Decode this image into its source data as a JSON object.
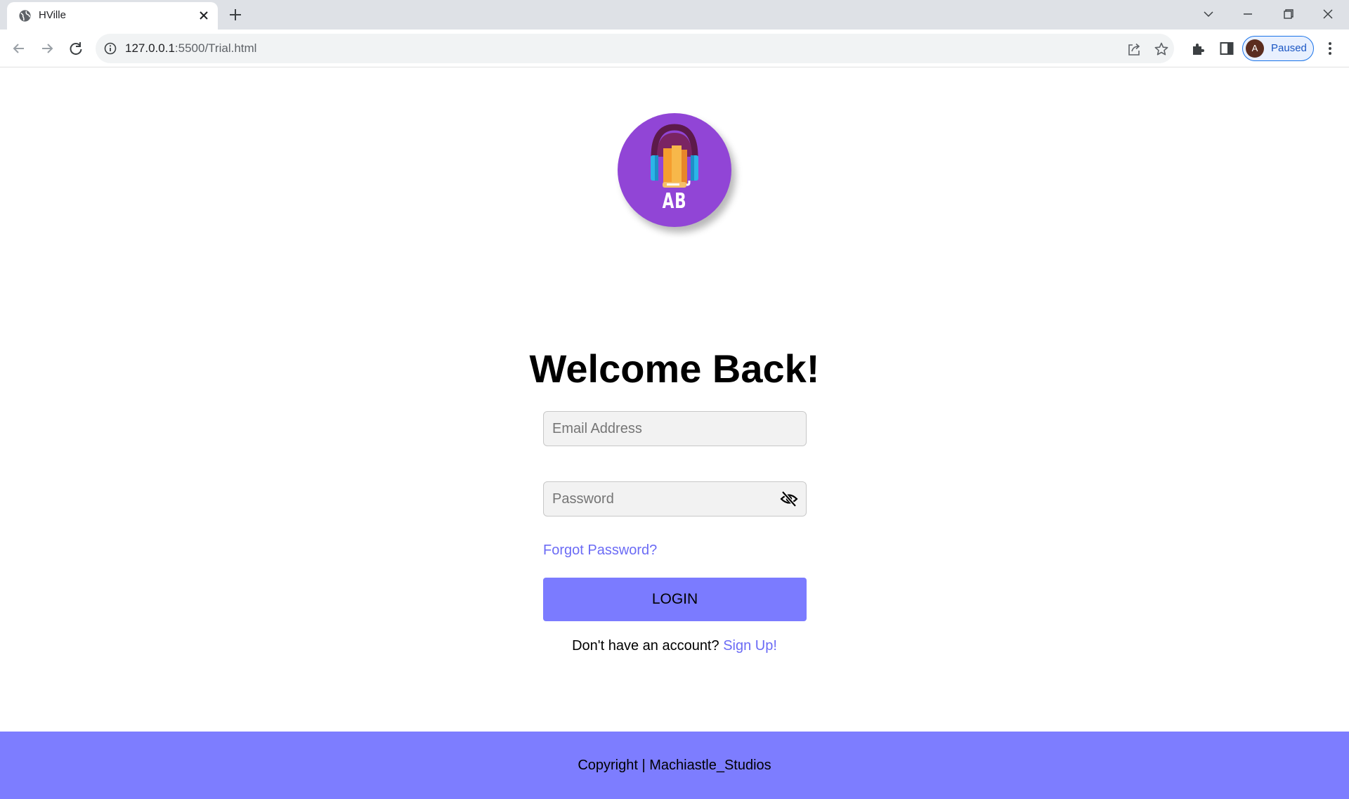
{
  "browser": {
    "tab": {
      "title": "HVille"
    },
    "url": {
      "host": "127.0.0.1",
      "rest": ":5500/Trial.html"
    },
    "profile": {
      "initial": "A",
      "status": "Paused"
    }
  },
  "page": {
    "logo": {
      "initials": "AB"
    },
    "heading": "Welcome Back!",
    "email": {
      "placeholder": "Email Address",
      "value": ""
    },
    "password": {
      "placeholder": "Password",
      "value": ""
    },
    "forgot_label": "Forgot Password?",
    "login_label": "LOGIN",
    "signup_prompt": "Don't have an account?",
    "signup_label": "Sign Up!",
    "footer_text": "Copyright | Machiastle_Studios"
  },
  "colors": {
    "accent": "#7b7bff",
    "link": "#6b6bf5",
    "logo_bg": "#9145d6"
  },
  "icons": [
    "globe-icon",
    "close-icon",
    "plus-icon",
    "back-icon",
    "forward-icon",
    "reload-icon",
    "info-icon",
    "share-icon",
    "star-icon",
    "puzzle-icon",
    "side-panel-icon",
    "kebab-icon",
    "eye-off-icon"
  ]
}
